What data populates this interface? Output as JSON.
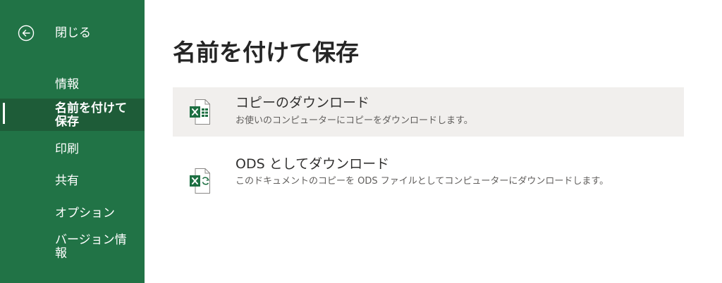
{
  "sidebar": {
    "back_label": "閉じる",
    "items": [
      {
        "label": "情報"
      },
      {
        "label": "名前を付けて保存"
      },
      {
        "label": "印刷"
      },
      {
        "label": "共有"
      },
      {
        "label": "オプション"
      },
      {
        "label": "バージョン情報"
      }
    ],
    "selected_index": 1
  },
  "main": {
    "title": "名前を付けて保存",
    "options": [
      {
        "title": "コピーのダウンロード",
        "description": "お使いのコンピューターにコピーをダウンロードします。",
        "icon": "excel-xlsx-icon"
      },
      {
        "title": "ODS としてダウンロード",
        "description": "このドキュメントのコピーを ODS ファイルとしてコンピューターにダウンロードします。",
        "icon": "excel-ods-icon"
      }
    ]
  },
  "colors": {
    "sidebar_bg": "#217346",
    "sidebar_selected_bg": "#1e5c38",
    "highlight_bg": "#f1efed",
    "excel_green": "#1d6f42"
  }
}
